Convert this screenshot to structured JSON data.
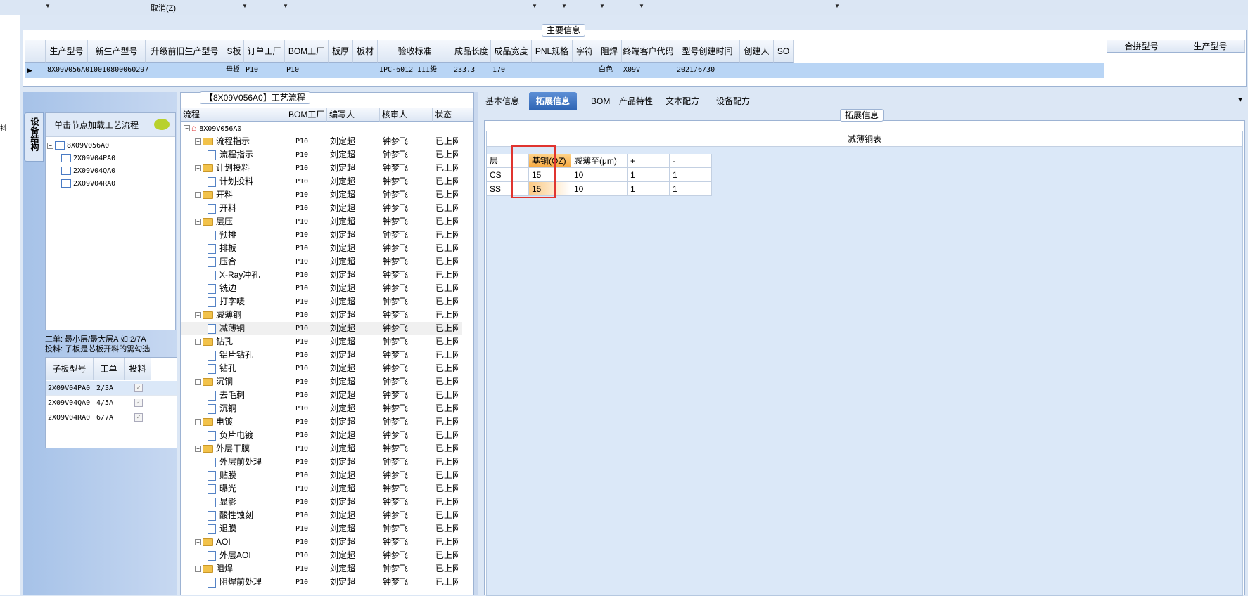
{
  "topbar": {
    "cancel_label": "取消(Z)"
  },
  "main_info": {
    "section_title": "主要信息",
    "columns": [
      "生产型号",
      "新生产型号",
      "升级前旧生产型号",
      "S板",
      "订单工厂",
      "BOM工厂",
      "板厚",
      "板材",
      "验收标准",
      "成品长度",
      "成品宽度",
      "PNL规格",
      "字符",
      "阻焊",
      "终端客户代码",
      "型号创建时间",
      "创建人",
      "SO"
    ],
    "row": {
      "c0": "8X09V056A0",
      "c1": "10010800060297",
      "c3": "母板",
      "c4": "P10",
      "c5": "P10",
      "c8": "IPC-6012 III级",
      "c9": "233.3",
      "c10": "170",
      "c13": "白色",
      "c14": "X09V",
      "c15": "2021/6/30"
    },
    "side_columns": [
      "合拼型号",
      "生产型号"
    ]
  },
  "left": {
    "vtab_label": "设备结构",
    "tree_header": "单击节点加载工艺流程",
    "tree_root": "8X09V056A0",
    "tree_children": [
      "2X09V04PA0",
      "2X09V04QA0",
      "2X09V04RA0"
    ],
    "note_line1": "工单: 最小层/最大层A 如:2/7A",
    "note_line2": "投料: 子板是芯板开料的需勾选",
    "sub_columns": [
      "子板型号",
      "工单",
      "投料"
    ],
    "sub_rows": [
      {
        "model": "2X09V04PA0",
        "order": "2/3A",
        "checked": "✓"
      },
      {
        "model": "2X09V04QA0",
        "order": "4/5A",
        "checked": "✓"
      },
      {
        "model": "2X09V04RA0",
        "order": "6/7A",
        "checked": "✓"
      }
    ]
  },
  "flow": {
    "panel_title": "【8X09V056A0】工艺流程",
    "columns": [
      "流程",
      "BOM工厂",
      "编写人",
      "核审人",
      "状态"
    ],
    "root": "8X09V056A0",
    "rows": [
      {
        "name": "流程指示",
        "level": 1,
        "bom": "P10",
        "author": "刘定超",
        "reviewer": "钟梦飞",
        "status": "已上网"
      },
      {
        "name": "流程指示",
        "level": 2,
        "bom": "P10",
        "author": "刘定超",
        "reviewer": "钟梦飞",
        "status": "已上网"
      },
      {
        "name": "计划投料",
        "level": 1,
        "bom": "P10",
        "author": "刘定超",
        "reviewer": "钟梦飞",
        "status": "已上网"
      },
      {
        "name": "计划投料",
        "level": 2,
        "bom": "P10",
        "author": "刘定超",
        "reviewer": "钟梦飞",
        "status": "已上网"
      },
      {
        "name": "开料",
        "level": 1,
        "bom": "P10",
        "author": "刘定超",
        "reviewer": "钟梦飞",
        "status": "已上网"
      },
      {
        "name": "开料",
        "level": 2,
        "bom": "P10",
        "author": "刘定超",
        "reviewer": "钟梦飞",
        "status": "已上网"
      },
      {
        "name": "层压",
        "level": 1,
        "bom": "P10",
        "author": "刘定超",
        "reviewer": "钟梦飞",
        "status": "已上网"
      },
      {
        "name": "预排",
        "level": 2,
        "bom": "P10",
        "author": "刘定超",
        "reviewer": "钟梦飞",
        "status": "已上网"
      },
      {
        "name": "排板",
        "level": 2,
        "bom": "P10",
        "author": "刘定超",
        "reviewer": "钟梦飞",
        "status": "已上网"
      },
      {
        "name": "压合",
        "level": 2,
        "bom": "P10",
        "author": "刘定超",
        "reviewer": "钟梦飞",
        "status": "已上网"
      },
      {
        "name": "X-Ray冲孔",
        "level": 2,
        "bom": "P10",
        "author": "刘定超",
        "reviewer": "钟梦飞",
        "status": "已上网"
      },
      {
        "name": "铣边",
        "level": 2,
        "bom": "P10",
        "author": "刘定超",
        "reviewer": "钟梦飞",
        "status": "已上网"
      },
      {
        "name": "打字唛",
        "level": 2,
        "bom": "P10",
        "author": "刘定超",
        "reviewer": "钟梦飞",
        "status": "已上网"
      },
      {
        "name": "减薄铜",
        "level": 1,
        "bom": "P10",
        "author": "刘定超",
        "reviewer": "钟梦飞",
        "status": "已上网"
      },
      {
        "name": "减薄铜",
        "level": 2,
        "bom": "P10",
        "author": "刘定超",
        "reviewer": "钟梦飞",
        "status": "已上网",
        "selected": true
      },
      {
        "name": "钻孔",
        "level": 1,
        "bom": "P10",
        "author": "刘定超",
        "reviewer": "钟梦飞",
        "status": "已上网"
      },
      {
        "name": "铝片钻孔",
        "level": 2,
        "bom": "P10",
        "author": "刘定超",
        "reviewer": "钟梦飞",
        "status": "已上网"
      },
      {
        "name": "钻孔",
        "level": 2,
        "bom": "P10",
        "author": "刘定超",
        "reviewer": "钟梦飞",
        "status": "已上网"
      },
      {
        "name": "沉铜",
        "level": 1,
        "bom": "P10",
        "author": "刘定超",
        "reviewer": "钟梦飞",
        "status": "已上网"
      },
      {
        "name": "去毛刺",
        "level": 2,
        "bom": "P10",
        "author": "刘定超",
        "reviewer": "钟梦飞",
        "status": "已上网"
      },
      {
        "name": "沉铜",
        "level": 2,
        "bom": "P10",
        "author": "刘定超",
        "reviewer": "钟梦飞",
        "status": "已上网"
      },
      {
        "name": "电镀",
        "level": 1,
        "bom": "P10",
        "author": "刘定超",
        "reviewer": "钟梦飞",
        "status": "已上网"
      },
      {
        "name": "负片电镀",
        "level": 2,
        "bom": "P10",
        "author": "刘定超",
        "reviewer": "钟梦飞",
        "status": "已上网"
      },
      {
        "name": "外层干膜",
        "level": 1,
        "bom": "P10",
        "author": "刘定超",
        "reviewer": "钟梦飞",
        "status": "已上网"
      },
      {
        "name": "外层前处理",
        "level": 2,
        "bom": "P10",
        "author": "刘定超",
        "reviewer": "钟梦飞",
        "status": "已上网"
      },
      {
        "name": "贴膜",
        "level": 2,
        "bom": "P10",
        "author": "刘定超",
        "reviewer": "钟梦飞",
        "status": "已上网"
      },
      {
        "name": "曝光",
        "level": 2,
        "bom": "P10",
        "author": "刘定超",
        "reviewer": "钟梦飞",
        "status": "已上网"
      },
      {
        "name": "显影",
        "level": 2,
        "bom": "P10",
        "author": "刘定超",
        "reviewer": "钟梦飞",
        "status": "已上网"
      },
      {
        "name": "酸性蚀刻",
        "level": 2,
        "bom": "P10",
        "author": "刘定超",
        "reviewer": "钟梦飞",
        "status": "已上网"
      },
      {
        "name": "退膜",
        "level": 2,
        "bom": "P10",
        "author": "刘定超",
        "reviewer": "钟梦飞",
        "status": "已上网"
      },
      {
        "name": "AOI",
        "level": 1,
        "bom": "P10",
        "author": "刘定超",
        "reviewer": "钟梦飞",
        "status": "已上网"
      },
      {
        "name": "外层AOI",
        "level": 2,
        "bom": "P10",
        "author": "刘定超",
        "reviewer": "钟梦飞",
        "status": "已上网"
      },
      {
        "name": "阻焊",
        "level": 1,
        "bom": "P10",
        "author": "刘定超",
        "reviewer": "钟梦飞",
        "status": "已上网"
      },
      {
        "name": "阻焊前处理",
        "level": 2,
        "bom": "P10",
        "author": "刘定超",
        "reviewer": "钟梦飞",
        "status": "已上网"
      }
    ]
  },
  "right": {
    "tabs": [
      "基本信息",
      "拓展信息",
      "BOM",
      "产品特性",
      "文本配方",
      "设备配方"
    ],
    "active_tab": "拓展信息",
    "section_title": "拓展信息",
    "table_title": "减薄铜表",
    "table_columns": [
      "层",
      "基铜(OZ)",
      "减薄至(μm)",
      "+",
      "-"
    ],
    "table_rows": [
      [
        "CS",
        "15",
        "10",
        "1",
        "1"
      ],
      [
        "SS",
        "15",
        "10",
        "1",
        "1"
      ]
    ]
  }
}
